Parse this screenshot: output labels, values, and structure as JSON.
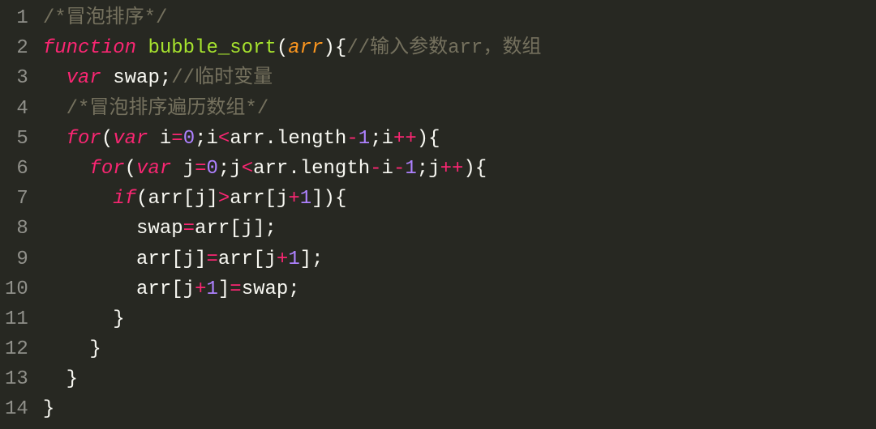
{
  "code": {
    "language": "javascript",
    "raw": "/*冒泡排序*/\nfunction bubble_sort(arr){//输入参数arr，数组\n  var swap;//临时变量\n  /*冒泡排序遍历数组*/\n  for(var i=0;i<arr.length-1;i++){\n    for(var j=0;j<arr.length-i-1;j++){\n      if(arr[j]>arr[j+1]){\n        swap=arr[j];\n        arr[j]=arr[j+1];\n        arr[j+1]=swap;\n      }\n    }\n  }\n}",
    "line_numbers": [
      "1",
      "2",
      "3",
      "4",
      "5",
      "6",
      "7",
      "8",
      "9",
      "10",
      "11",
      "12",
      "13",
      "14"
    ],
    "lines": [
      [
        {
          "cls": "cm",
          "t": "/*冒泡排序*/"
        }
      ],
      [
        {
          "cls": "kw",
          "t": "function"
        },
        {
          "cls": "pn",
          "t": " "
        },
        {
          "cls": "fn",
          "t": "bubble_sort"
        },
        {
          "cls": "pn",
          "t": "("
        },
        {
          "cls": "arg",
          "t": "arr"
        },
        {
          "cls": "pn",
          "t": "){"
        },
        {
          "cls": "cm",
          "t": "//输入参数arr，数组"
        }
      ],
      [
        {
          "cls": "pn",
          "t": "  "
        },
        {
          "cls": "kw",
          "t": "var"
        },
        {
          "cls": "pn",
          "t": " "
        },
        {
          "cls": "id",
          "t": "swap"
        },
        {
          "cls": "pn",
          "t": ";"
        },
        {
          "cls": "cm",
          "t": "//临时变量"
        }
      ],
      [
        {
          "cls": "pn",
          "t": "  "
        },
        {
          "cls": "cm",
          "t": "/*冒泡排序遍历数组*/"
        }
      ],
      [
        {
          "cls": "pn",
          "t": "  "
        },
        {
          "cls": "kw",
          "t": "for"
        },
        {
          "cls": "pn",
          "t": "("
        },
        {
          "cls": "kw",
          "t": "var"
        },
        {
          "cls": "pn",
          "t": " "
        },
        {
          "cls": "id",
          "t": "i"
        },
        {
          "cls": "op",
          "t": "="
        },
        {
          "cls": "nm",
          "t": "0"
        },
        {
          "cls": "pn",
          "t": ";"
        },
        {
          "cls": "id",
          "t": "i"
        },
        {
          "cls": "op",
          "t": "<"
        },
        {
          "cls": "id",
          "t": "arr.length"
        },
        {
          "cls": "op",
          "t": "-"
        },
        {
          "cls": "nm",
          "t": "1"
        },
        {
          "cls": "pn",
          "t": ";"
        },
        {
          "cls": "id",
          "t": "i"
        },
        {
          "cls": "op",
          "t": "++"
        },
        {
          "cls": "pn",
          "t": "){"
        }
      ],
      [
        {
          "cls": "pn",
          "t": "    "
        },
        {
          "cls": "kw",
          "t": "for"
        },
        {
          "cls": "pn",
          "t": "("
        },
        {
          "cls": "kw",
          "t": "var"
        },
        {
          "cls": "pn",
          "t": " "
        },
        {
          "cls": "id",
          "t": "j"
        },
        {
          "cls": "op",
          "t": "="
        },
        {
          "cls": "nm",
          "t": "0"
        },
        {
          "cls": "pn",
          "t": ";"
        },
        {
          "cls": "id",
          "t": "j"
        },
        {
          "cls": "op",
          "t": "<"
        },
        {
          "cls": "id",
          "t": "arr.length"
        },
        {
          "cls": "op",
          "t": "-"
        },
        {
          "cls": "id",
          "t": "i"
        },
        {
          "cls": "op",
          "t": "-"
        },
        {
          "cls": "nm",
          "t": "1"
        },
        {
          "cls": "pn",
          "t": ";"
        },
        {
          "cls": "id",
          "t": "j"
        },
        {
          "cls": "op",
          "t": "++"
        },
        {
          "cls": "pn",
          "t": "){"
        }
      ],
      [
        {
          "cls": "pn",
          "t": "      "
        },
        {
          "cls": "kw",
          "t": "if"
        },
        {
          "cls": "pn",
          "t": "("
        },
        {
          "cls": "id",
          "t": "arr"
        },
        {
          "cls": "pn",
          "t": "["
        },
        {
          "cls": "id",
          "t": "j"
        },
        {
          "cls": "pn",
          "t": "]"
        },
        {
          "cls": "op",
          "t": ">"
        },
        {
          "cls": "id",
          "t": "arr"
        },
        {
          "cls": "pn",
          "t": "["
        },
        {
          "cls": "id",
          "t": "j"
        },
        {
          "cls": "op",
          "t": "+"
        },
        {
          "cls": "nm",
          "t": "1"
        },
        {
          "cls": "pn",
          "t": "]){"
        }
      ],
      [
        {
          "cls": "pn",
          "t": "        "
        },
        {
          "cls": "id",
          "t": "swap"
        },
        {
          "cls": "op",
          "t": "="
        },
        {
          "cls": "id",
          "t": "arr"
        },
        {
          "cls": "pn",
          "t": "["
        },
        {
          "cls": "id",
          "t": "j"
        },
        {
          "cls": "pn",
          "t": "];"
        }
      ],
      [
        {
          "cls": "pn",
          "t": "        "
        },
        {
          "cls": "id",
          "t": "arr"
        },
        {
          "cls": "pn",
          "t": "["
        },
        {
          "cls": "id",
          "t": "j"
        },
        {
          "cls": "pn",
          "t": "]"
        },
        {
          "cls": "op",
          "t": "="
        },
        {
          "cls": "id",
          "t": "arr"
        },
        {
          "cls": "pn",
          "t": "["
        },
        {
          "cls": "id",
          "t": "j"
        },
        {
          "cls": "op",
          "t": "+"
        },
        {
          "cls": "nm",
          "t": "1"
        },
        {
          "cls": "pn",
          "t": "];"
        }
      ],
      [
        {
          "cls": "pn",
          "t": "        "
        },
        {
          "cls": "id",
          "t": "arr"
        },
        {
          "cls": "pn",
          "t": "["
        },
        {
          "cls": "id",
          "t": "j"
        },
        {
          "cls": "op",
          "t": "+"
        },
        {
          "cls": "nm",
          "t": "1"
        },
        {
          "cls": "pn",
          "t": "]"
        },
        {
          "cls": "op",
          "t": "="
        },
        {
          "cls": "id",
          "t": "swap"
        },
        {
          "cls": "pn",
          "t": ";"
        }
      ],
      [
        {
          "cls": "pn",
          "t": "      }"
        }
      ],
      [
        {
          "cls": "pn",
          "t": "    }"
        }
      ],
      [
        {
          "cls": "pn",
          "t": "  }"
        }
      ],
      [
        {
          "cls": "pn",
          "t": "}"
        }
      ]
    ]
  }
}
